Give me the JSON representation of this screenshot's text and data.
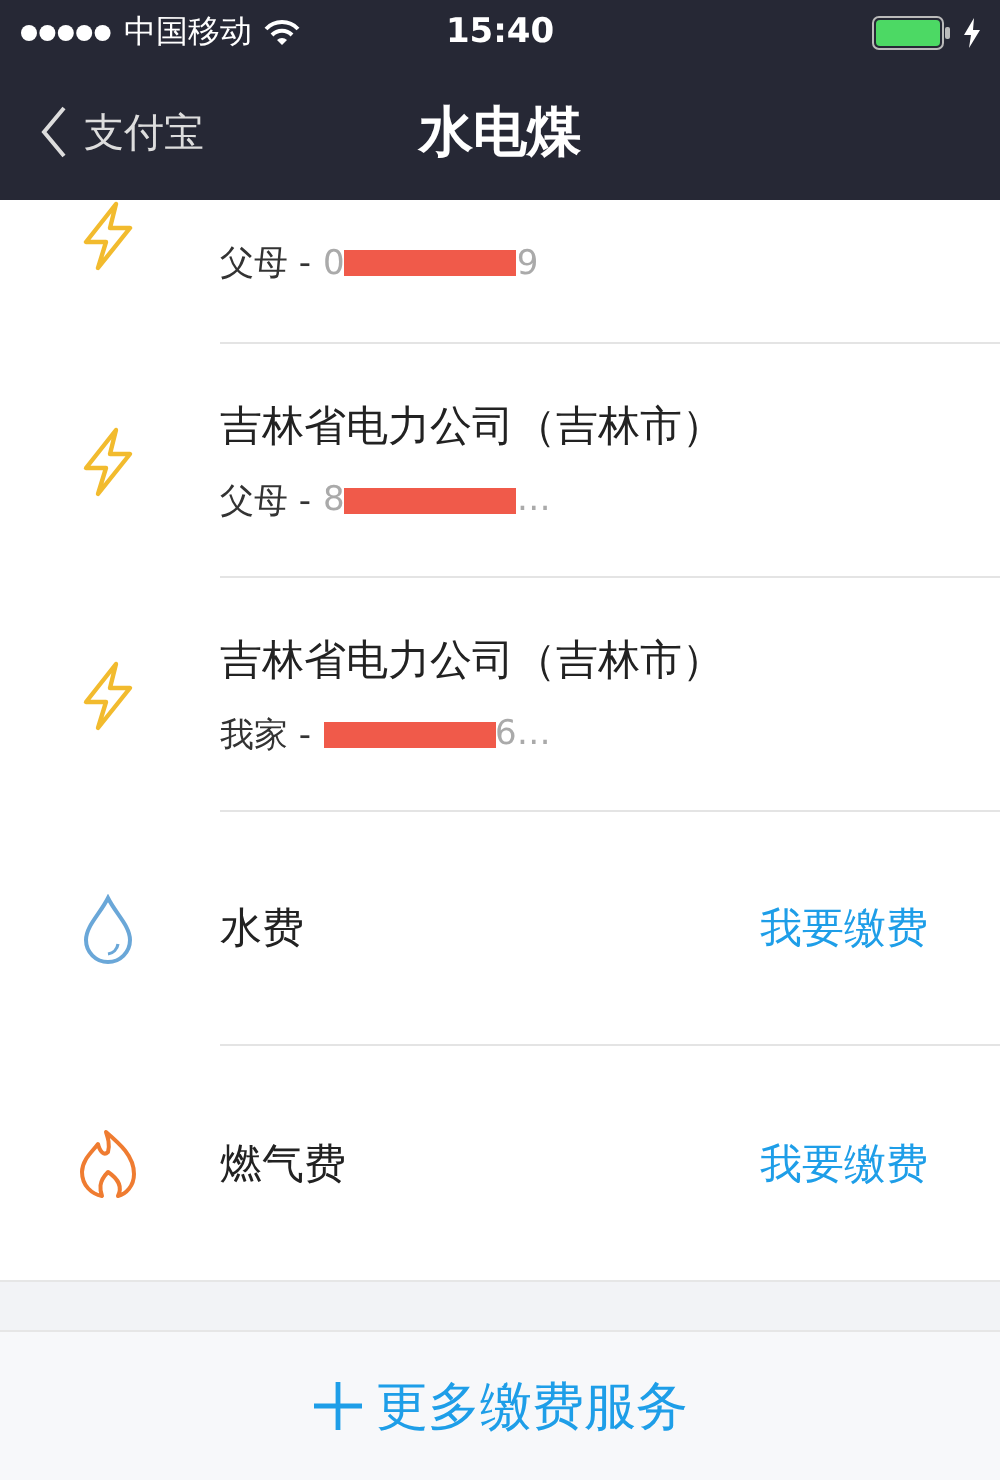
{
  "status_bar": {
    "carrier": "中国移动",
    "time": "15:40",
    "charging": true
  },
  "nav": {
    "back_label": "支付宝",
    "title": "水电煤"
  },
  "items": [
    {
      "kind": "electricity",
      "owner": "父母 -",
      "account_start": "0",
      "account_end": "9",
      "redacted": true
    },
    {
      "kind": "electricity",
      "title": "吉林省电力公司（吉林市）",
      "owner": "父母 -",
      "account_start": "8",
      "account_end": "…",
      "redacted": true
    },
    {
      "kind": "electricity",
      "title": "吉林省电力公司（吉林市）",
      "owner": "我家 -",
      "account_end": "6…",
      "redacted": true
    },
    {
      "kind": "water",
      "title": "水费",
      "action": "我要缴费"
    },
    {
      "kind": "gas",
      "title": "燃气费",
      "action": "我要缴费"
    }
  ],
  "more_button": {
    "label": "更多缴费服务"
  }
}
